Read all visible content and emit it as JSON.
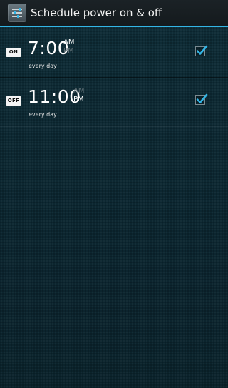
{
  "header": {
    "title": "Schedule power on & off",
    "icon": "sliders-icon"
  },
  "schedules": [
    {
      "badge": "ON",
      "time": "7:00",
      "am": "AM",
      "pm": "PM",
      "period_active": "AM",
      "repeat": "every day",
      "enabled": true
    },
    {
      "badge": "OFF",
      "time": "11:00",
      "am": "AM",
      "pm": "PM",
      "period_active": "PM",
      "repeat": "every day",
      "enabled": true
    }
  ],
  "colors": {
    "accent": "#33b5e5",
    "background": "#0e2a33",
    "action_bar": "#171d20",
    "inactive_period": "#5f6f75"
  }
}
